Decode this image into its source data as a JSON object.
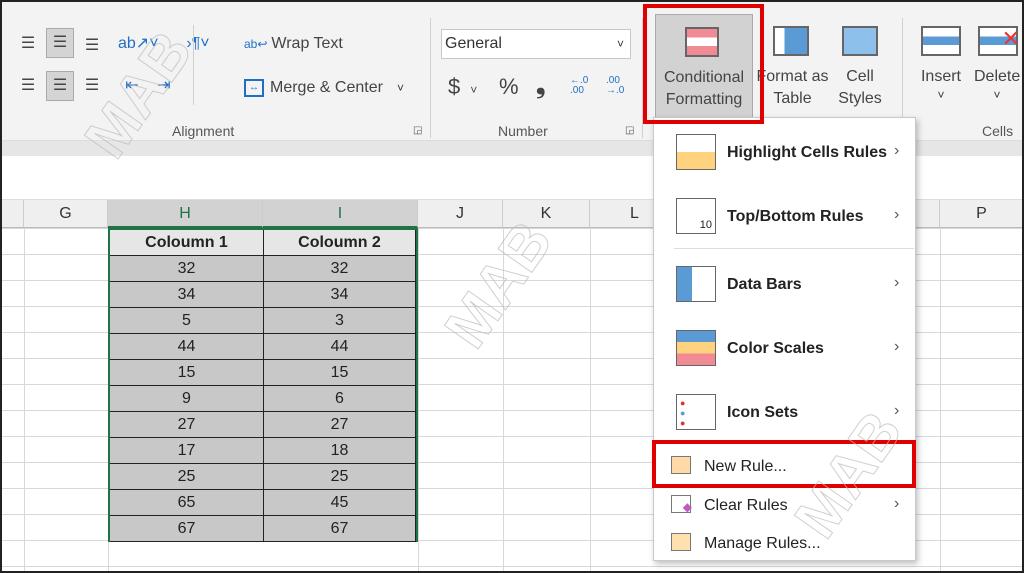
{
  "ribbon": {
    "alignment": {
      "wrap_text": "Wrap Text",
      "merge_center": "Merge & Center",
      "group_label": "Alignment"
    },
    "number": {
      "format_value": "General",
      "currency": "$",
      "percent": "%",
      "comma": "❟",
      "increase_decimal": "←.0 .00",
      "decrease_decimal": ".00 →.0",
      "group_label": "Number"
    },
    "styles": {
      "conditional_formatting": "Conditional Formatting",
      "format_as_table": "Format as Table",
      "cell_styles": "Cell Styles"
    },
    "cells": {
      "insert": "Insert",
      "delete": "Delete",
      "group_label": "Cells"
    }
  },
  "columns": [
    "G",
    "H",
    "I",
    "J",
    "K",
    "L",
    "P"
  ],
  "table": {
    "headers": [
      "Coloumn 1",
      "Coloumn 2"
    ],
    "rows": [
      [
        32,
        32
      ],
      [
        34,
        34
      ],
      [
        5,
        3
      ],
      [
        44,
        44
      ],
      [
        15,
        15
      ],
      [
        9,
        6
      ],
      [
        27,
        27
      ],
      [
        17,
        18
      ],
      [
        25,
        25
      ],
      [
        65,
        45
      ],
      [
        67,
        67
      ]
    ]
  },
  "menu": {
    "items": [
      {
        "label": "Highlight Cells Rules",
        "submenu": true
      },
      {
        "label": "Top/Bottom Rules",
        "submenu": true
      },
      {
        "label": "Data Bars",
        "submenu": true
      },
      {
        "label": "Color Scales",
        "submenu": true
      },
      {
        "label": "Icon Sets",
        "submenu": true
      },
      {
        "label": "New Rule...",
        "submenu": false,
        "highlighted": true
      },
      {
        "label": "Clear Rules",
        "submenu": true
      },
      {
        "label": "Manage Rules...",
        "submenu": false
      }
    ]
  },
  "watermark": "MAB",
  "colors": {
    "highlight_box": "#e00000",
    "selection": "#217346",
    "selected_cells": "#c8c8c8"
  }
}
